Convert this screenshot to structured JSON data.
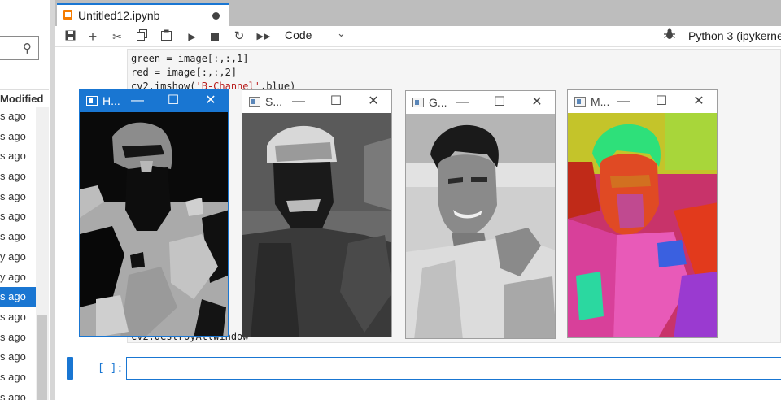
{
  "file_browser": {
    "column_header": "Modified",
    "rows": [
      "s ago",
      "s ago",
      "s ago",
      "s ago",
      "s ago",
      "s ago",
      "s ago",
      "y ago",
      "y ago",
      "s ago",
      "s ago",
      "s ago",
      "s ago",
      "s ago",
      "s ago"
    ],
    "selected_index": 9
  },
  "notebook_tab": {
    "title": "Untitled12.ipynb"
  },
  "toolbar": {
    "cell_type": "Code",
    "kernel": "Python 3 (ipykernel)"
  },
  "code": {
    "line1": "green = image[:,:,1]",
    "line2": "red = image[:,:,2]",
    "line3_fn": "cv2.imshow(",
    "line3_str": "'B-Channel'",
    "line3_rest": ",blue)",
    "last_line": "cv2.destroyAllWindow"
  },
  "input_prompt": "[ ]:",
  "windows": {
    "hsv": {
      "title": "H..."
    },
    "saturation": {
      "title": "S..."
    },
    "gray": {
      "title": "G..."
    },
    "merged": {
      "title": "M..."
    }
  }
}
